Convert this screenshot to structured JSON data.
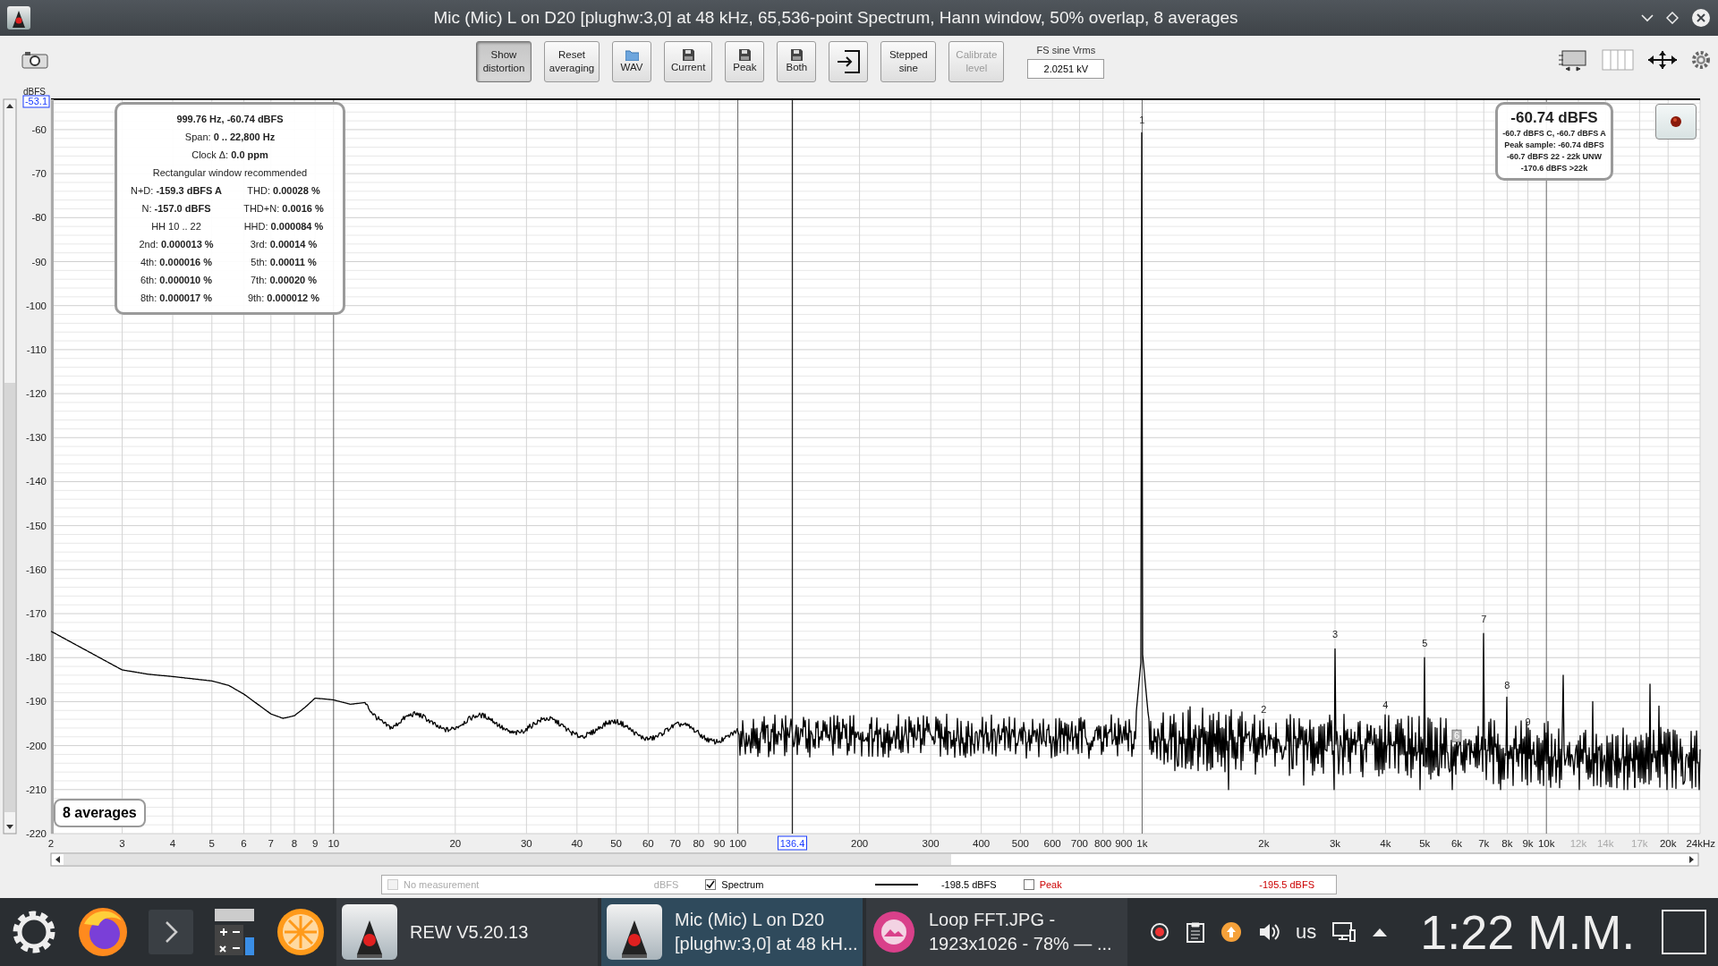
{
  "window": {
    "title": "Mic (Mic) L on D20 [plughw:3,0] at 48 kHz, 65,536-point Spectrum, Hann window, 50% overlap, 8 averages"
  },
  "toolbar": {
    "buttons": [
      {
        "kind": "text",
        "label": "Show distortion",
        "selected": true,
        "disabled": false
      },
      {
        "kind": "text",
        "label": "Reset averaging",
        "selected": false,
        "disabled": false
      },
      {
        "kind": "open",
        "label": "WAV",
        "selected": false,
        "disabled": false
      },
      {
        "kind": "save",
        "label": "Current",
        "selected": false,
        "disabled": false
      },
      {
        "kind": "save",
        "label": "Peak",
        "selected": false,
        "disabled": false
      },
      {
        "kind": "save",
        "label": "Both",
        "selected": false,
        "disabled": false
      },
      {
        "kind": "import",
        "selected": false,
        "disabled": false
      },
      {
        "kind": "text",
        "label": "Stepped sine",
        "selected": false,
        "disabled": false
      },
      {
        "kind": "text",
        "label": "Calibrate level",
        "selected": false,
        "disabled": true
      }
    ],
    "fs_field": {
      "label": "FS sine Vrms",
      "value": "2.0251 kV"
    }
  },
  "distortion_panel": {
    "header": "999.76 Hz, -60.74 dBFS",
    "lines": [
      "Span: **0 .. 22,800 Hz**",
      "Clock Δ: **0.0 ppm**",
      "Rectangular window recommended"
    ],
    "pairs": [
      [
        "N+D: **-159.3 dBFS A**",
        "THD: **0.00028 %**"
      ],
      [
        "N: **-157.0 dBFS**",
        "THD+N: **0.0016 %**"
      ],
      [
        "HH 10 .. 22",
        "HHD: **0.000084 %**"
      ],
      [
        "2nd: **0.000013 %**",
        "3rd: **0.00014 %**"
      ],
      [
        "4th: **0.000016 %**",
        "5th: **0.00011 %**"
      ],
      [
        "6th: **0.000010 %**",
        "7th: **0.00020 %**"
      ],
      [
        "8th: **0.000017 %**",
        "9th: **0.000012 %**"
      ]
    ]
  },
  "level_panel": {
    "level": "-60.74 dBFS",
    "details": [
      "-60.7 dBFS C, -60.7 dBFS A",
      "Peak sample: -60.74 dBFS",
      "-60.7 dBFS 22 - 22k UNW",
      "-170.6 dBFS >22k"
    ]
  },
  "averages_badge": "8 averages",
  "chart": {
    "y_unit": "dBFS",
    "top_label": "-53.1",
    "y_labels": [
      "-60",
      "-70",
      "-80",
      "-90",
      "-100",
      "-110",
      "-120",
      "-130",
      "-140",
      "-150",
      "-160",
      "-170",
      "-180",
      "-190",
      "-200",
      "-210",
      "-220"
    ],
    "x_labels": [
      {
        "text": "2",
        "muted": false
      },
      {
        "text": "3",
        "muted": false
      },
      {
        "text": "4",
        "muted": false
      },
      {
        "text": "5",
        "muted": false
      },
      {
        "text": "6",
        "muted": false
      },
      {
        "text": "7",
        "muted": false
      },
      {
        "text": "8",
        "muted": false
      },
      {
        "text": "9",
        "muted": false
      },
      {
        "text": "10",
        "muted": false
      },
      {
        "text": "20",
        "muted": false
      },
      {
        "text": "30",
        "muted": false
      },
      {
        "text": "40",
        "muted": false
      },
      {
        "text": "50",
        "muted": false
      },
      {
        "text": "60",
        "muted": false
      },
      {
        "text": "70",
        "muted": false
      },
      {
        "text": "80",
        "muted": false
      },
      {
        "text": "90",
        "muted": false
      },
      {
        "text": "100",
        "muted": false
      },
      {
        "text": "200",
        "muted": false
      },
      {
        "text": "300",
        "muted": false
      },
      {
        "text": "400",
        "muted": false
      },
      {
        "text": "500",
        "muted": false
      },
      {
        "text": "600",
        "muted": false
      },
      {
        "text": "700",
        "muted": false
      },
      {
        "text": "800",
        "muted": false
      },
      {
        "text": "900",
        "muted": false
      },
      {
        "text": "1k",
        "muted": false
      },
      {
        "text": "2k",
        "muted": false
      },
      {
        "text": "3k",
        "muted": false
      },
      {
        "text": "4k",
        "muted": false
      },
      {
        "text": "5k",
        "muted": false
      },
      {
        "text": "6k",
        "muted": false
      },
      {
        "text": "7k",
        "muted": false
      },
      {
        "text": "8k",
        "muted": false
      },
      {
        "text": "9k",
        "muted": false
      },
      {
        "text": "10k",
        "muted": false
      },
      {
        "text": "12k",
        "muted": true
      },
      {
        "text": "14k",
        "muted": true
      },
      {
        "text": "17k",
        "muted": true
      },
      {
        "text": "20k",
        "muted": false
      },
      {
        "text": "24kHz",
        "muted": false
      }
    ],
    "cursor_label": "136.4",
    "harmonic_labels": [
      {
        "text": "1",
        "boxed": false
      },
      {
        "text": "2",
        "boxed": false
      },
      {
        "text": "3",
        "boxed": false
      },
      {
        "text": "4",
        "boxed": false
      },
      {
        "text": "5",
        "boxed": false
      },
      {
        "text": "6",
        "boxed": true
      },
      {
        "text": "7",
        "boxed": false
      },
      {
        "text": "8",
        "boxed": false
      },
      {
        "text": "9",
        "boxed": false
      }
    ]
  },
  "legend": {
    "items": [
      {
        "label": "No measurement",
        "checked": false,
        "disabled": true,
        "show_line": false,
        "reading": "dBFS",
        "color": "#aaaaaa"
      },
      {
        "label": "Spectrum",
        "checked": true,
        "disabled": false,
        "show_line": true,
        "reading": "-198.5 dBFS",
        "color": "#000000"
      },
      {
        "label": "Peak",
        "checked": false,
        "disabled": false,
        "show_line": false,
        "reading": "-195.5 dBFS",
        "color": "#cc0000"
      }
    ]
  },
  "taskbar": {
    "tasks": [
      {
        "lines": [
          "REW V5.20.13"
        ],
        "selected": false,
        "kind": "app"
      },
      {
        "lines": [
          "Mic (Mic) L on D20",
          "[plughw:3,0] at 48 kH..."
        ],
        "selected": true,
        "kind": "app"
      },
      {
        "lines": [
          "Loop FFT.JPG -",
          "1923x1026 - 78% — ..."
        ],
        "selected": false,
        "kind": "viewer"
      }
    ],
    "keyboard_layout": "us",
    "clock": "1:22 M.M."
  }
}
